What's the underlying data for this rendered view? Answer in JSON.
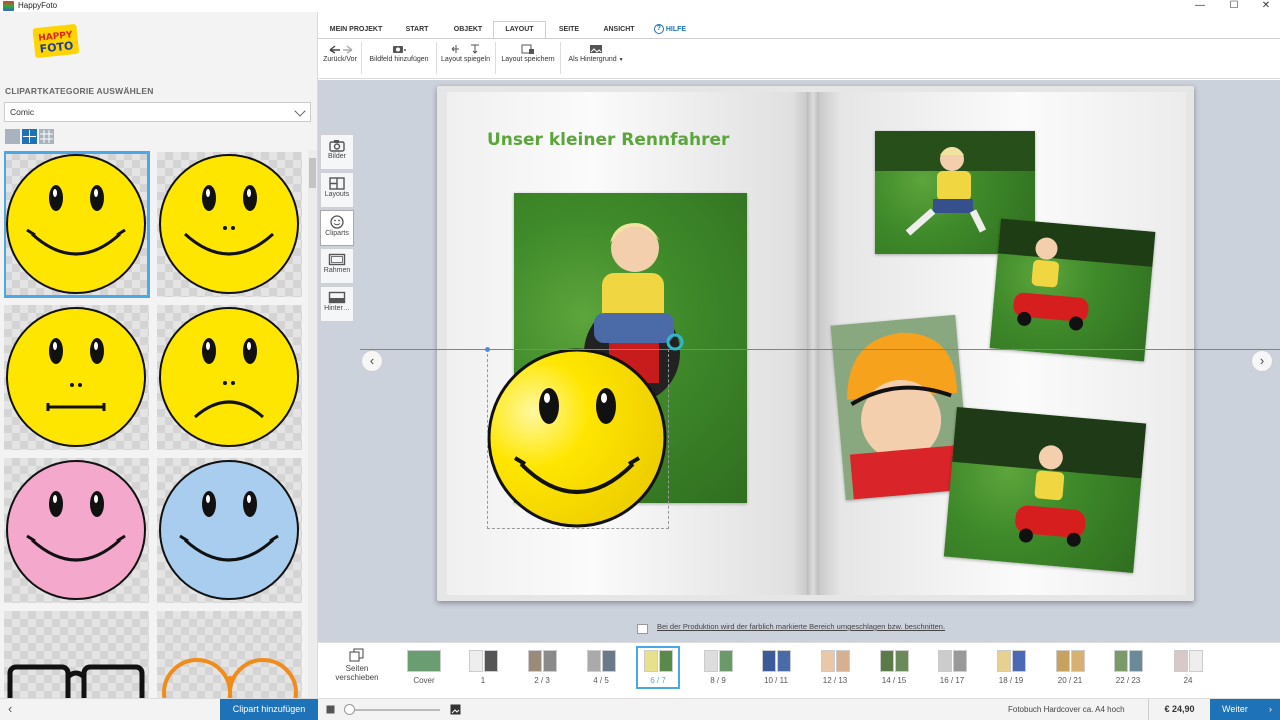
{
  "window": {
    "title": "HappyFoto",
    "minimize": "—",
    "maximize": "☐",
    "close": "✕"
  },
  "logo": {
    "line1": "HAPPY",
    "line2": "FOTO"
  },
  "left_panel": {
    "heading": "CLIPARTKATEGORIE AUSWÄHLEN",
    "category_value": "Comic",
    "add_button": "Clipart hinzufügen",
    "back_arrow": "‹"
  },
  "cliparts": [
    {
      "name": "smiley-yellow-smile",
      "color": "#ffe600",
      "mouth": "smile",
      "selected": true
    },
    {
      "name": "smiley-yellow-nose-smile",
      "color": "#ffe600",
      "mouth": "smile-nose"
    },
    {
      "name": "smiley-yellow-neutral",
      "color": "#ffe600",
      "mouth": "flat"
    },
    {
      "name": "smiley-yellow-sad",
      "color": "#ffe600",
      "mouth": "sad"
    },
    {
      "name": "smiley-pink",
      "color": "#f3a8cc",
      "mouth": "smile"
    },
    {
      "name": "smiley-blue",
      "color": "#a8cdef",
      "mouth": "smile"
    },
    {
      "name": "glasses-black",
      "color": "#111111"
    },
    {
      "name": "glasses-orange",
      "color": "#f08c1c"
    }
  ],
  "tabs": [
    "MEIN PROJEKT",
    "START",
    "OBJEKT",
    "LAYOUT",
    "SEITE",
    "ANSICHT",
    "HILFE"
  ],
  "active_tab": "LAYOUT",
  "ribbon": {
    "undo": "Zurück/Vor",
    "add_frame": "Bildfeld hinzufügen",
    "mirror": "Layout spiegeln",
    "save_layout": "Layout speichern",
    "as_background": "Als Hintergrund"
  },
  "side_tools": [
    {
      "label": "Bilder",
      "icon": "camera-icon"
    },
    {
      "label": "Layouts",
      "icon": "layout-icon"
    },
    {
      "label": "Cliparts",
      "icon": "smiley-icon",
      "active": true
    },
    {
      "label": "Rahmen",
      "icon": "frame-icon"
    },
    {
      "label": "Hinter…",
      "icon": "background-icon"
    }
  ],
  "page_title": "Unser kleiner Rennfahrer",
  "trim_note": "Bei der Produktion wird der farblich markierte Bereich umgeschlagen bzw. beschnitten.",
  "page_strip": {
    "move_pages": "Seiten verschieben",
    "thumbs": [
      "Cover",
      "1",
      "2 / 3",
      "4 / 5",
      "6 / 7",
      "8 / 9",
      "10 / 11",
      "12 / 13",
      "14 / 15",
      "16 / 17",
      "18 / 19",
      "20 / 21",
      "22 / 23",
      "24"
    ],
    "selected": "6 / 7"
  },
  "status": {
    "product": "Fotobuch Hardcover ca. A4 hoch",
    "price": "€ 24,90",
    "next": "Weiter"
  },
  "colors": {
    "accent": "#1d72b8",
    "selection": "#4aa8e8",
    "title_green": "#5aa63a",
    "smiley_yellow": "#ffe600"
  }
}
